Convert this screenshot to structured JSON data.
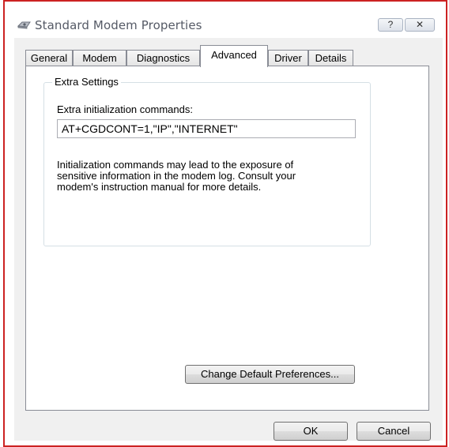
{
  "window": {
    "title": "Standard Modem Properties",
    "help_label": "?",
    "close_label": "✕"
  },
  "tabs": [
    {
      "label": "General"
    },
    {
      "label": "Modem"
    },
    {
      "label": "Diagnostics"
    },
    {
      "label": "Advanced"
    },
    {
      "label": "Driver"
    },
    {
      "label": "Details"
    }
  ],
  "active_tab": "Advanced",
  "extra_settings": {
    "group_title": "Extra Settings",
    "field_label": "Extra initialization commands:",
    "field_value": "AT+CGDCONT=1,\"IP\",\"INTERNET\"",
    "info_text": "Initialization commands may lead to the exposure of sensitive information in the modem log. Consult your modem's instruction manual for more details."
  },
  "buttons": {
    "change_defaults": "Change Default Preferences...",
    "ok": "OK",
    "cancel": "Cancel"
  },
  "colors": {
    "window_border": "#cc2222",
    "face": "#f0f0f0"
  }
}
